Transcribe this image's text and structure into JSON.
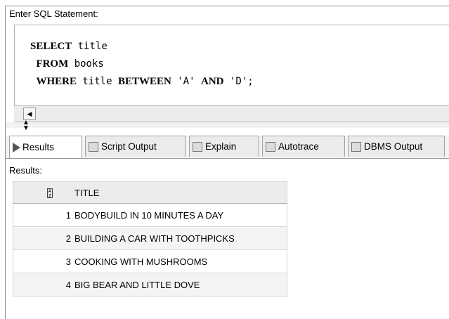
{
  "sql_panel": {
    "label": "Enter SQL Statement:",
    "lines": [
      {
        "keyword": "SELECT",
        "rest": " title"
      },
      {
        "keyword": "FROM",
        "rest": " books"
      },
      {
        "keyword": "WHERE",
        "rest": " title ",
        "kw2": "BETWEEN",
        "rest2": " 'A' ",
        "kw3": "AND",
        "rest3": " 'D';"
      }
    ]
  },
  "tabs": [
    {
      "label": "Results",
      "icon": "play-icon"
    },
    {
      "label": "Script Output",
      "icon": "script-icon"
    },
    {
      "label": "Explain",
      "icon": "explain-icon"
    },
    {
      "label": "Autotrace",
      "icon": "autotrace-icon"
    },
    {
      "label": "DBMS Output",
      "icon": "dbms-icon"
    }
  ],
  "results": {
    "label": "Results:",
    "column_header": "TITLE",
    "rows": [
      {
        "num": "1",
        "title": "BODYBUILD IN 10 MINUTES A DAY"
      },
      {
        "num": "2",
        "title": "BUILDING A CAR WITH TOOTHPICKS"
      },
      {
        "num": "3",
        "title": "COOKING WITH MUSHROOMS"
      },
      {
        "num": "4",
        "title": "BIG BEAR AND LITTLE DOVE"
      }
    ]
  }
}
